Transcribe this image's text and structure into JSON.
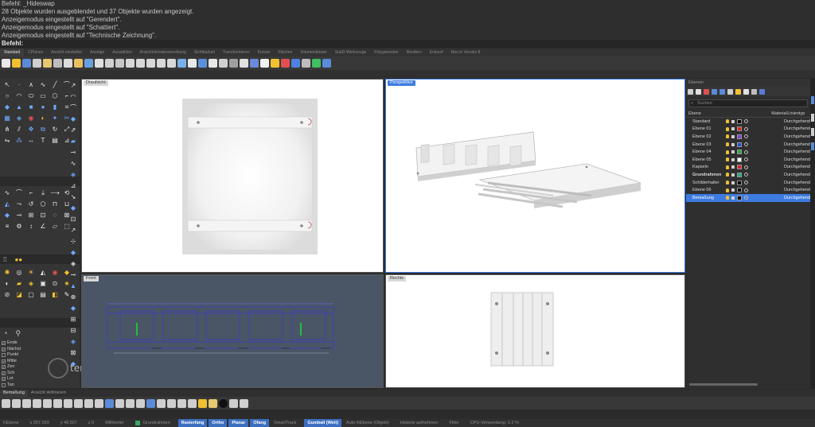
{
  "command_history": [
    "Befehl: _Hideswap",
    "28 Objekte wurden ausgeblendet und 37 Objekte wurden angezeigt.",
    "Anzeigemodus eingestellt auf \"Gerendert\".",
    "Anzeigemodus eingestellt auf \"Schattiert\".",
    "Anzeigemodus eingestellt auf \"Technische Zeichnung\"."
  ],
  "command_prompt": "Befehl:",
  "toolbar_tabs": [
    "Standard",
    "CPlanes",
    "Ansicht einstellen",
    "Anzeige",
    "Auswählen",
    "Ansichtsfensteranordnung",
    "Sichtbarkeit",
    "Transformieren",
    "Kurven",
    "Flächen",
    "Volumenkörper",
    "SubD-Werkzeuge",
    "Polygonnetze",
    "Rendern",
    "Entwurf",
    "Neu in Version 8"
  ],
  "active_toolbar_tab": "Standard",
  "viewports": {
    "top": {
      "label": "Draufsicht"
    },
    "perspective": {
      "label": "Perspektive"
    },
    "front": {
      "label": "Front"
    },
    "right": {
      "label": "Rechts"
    }
  },
  "osnaps": [
    {
      "label": "Ende",
      "checked": true
    },
    {
      "label": "Nächst",
      "checked": true
    },
    {
      "label": "Punkt",
      "checked": false
    },
    {
      "label": "Mitte",
      "checked": true
    },
    {
      "label": "Zen",
      "checked": true
    },
    {
      "label": "Sch",
      "checked": true
    },
    {
      "label": "Lot",
      "checked": true
    },
    {
      "label": "Tan",
      "checked": false
    }
  ],
  "watermark_text": "tende-Art",
  "layers_panel": {
    "title": "Ebenen",
    "search_placeholder": "Suchen",
    "col_layer": "Ebene",
    "col_material": "Material",
    "col_linetype": "Linientyp",
    "rows": [
      {
        "name": "Standard",
        "color": "#000000",
        "linetype": "Durchgehend",
        "bold": false,
        "selected": false
      },
      {
        "name": "Ebene 01",
        "color": "#e02020",
        "linetype": "Durchgehend",
        "bold": false,
        "selected": false
      },
      {
        "name": "Ebene 02",
        "color": "#8a3ad8",
        "linetype": "Durchgehend",
        "bold": false,
        "selected": false
      },
      {
        "name": "Ebene 03",
        "color": "#2a4ae0",
        "linetype": "Durchgehend",
        "bold": false,
        "selected": false
      },
      {
        "name": "Ebene 04",
        "color": "#20b040",
        "linetype": "Durchgehend",
        "bold": false,
        "selected": false
      },
      {
        "name": "Ebene 05",
        "color": "#ffffff",
        "linetype": "Durchgehend",
        "bold": false,
        "selected": false
      },
      {
        "name": "Kapseln",
        "color": "#e02020",
        "linetype": "Durchgehend",
        "bold": false,
        "selected": false
      },
      {
        "name": "Grundrahmen",
        "color": "#20b080",
        "linetype": "Durchgehend",
        "bold": true,
        "selected": false
      },
      {
        "name": "Schilderhalter",
        "color": "#000000",
        "linetype": "Durchgehend",
        "bold": false,
        "selected": false
      },
      {
        "name": "Ebene 06",
        "color": "#000000",
        "linetype": "Durchgehend",
        "bold": false,
        "selected": false
      },
      {
        "name": "Bemaßung",
        "color": "#000000",
        "linetype": "Durchgehend",
        "bold": false,
        "selected": true
      }
    ]
  },
  "bottom_tabs": [
    "Bemaßung",
    "Ansicht definieren"
  ],
  "status_bar": {
    "cplane": "KEbene",
    "x": "x 257.393",
    "y": "y 48.557",
    "z": "z 0",
    "unit": "Millimeter",
    "layer": "Grundrahmen",
    "buttons": [
      "Rasterfang",
      "Ortho",
      "Planar",
      "Ofang"
    ],
    "smarttrack": "SmartTrack",
    "gumball": "Gumball (Welt)",
    "autocplane": "Auto-KEbene (Objekt)",
    "history": "Historie aufnehmen",
    "filter": "Filter",
    "cpu": "CPU-Verwendung: 0.2 %"
  }
}
